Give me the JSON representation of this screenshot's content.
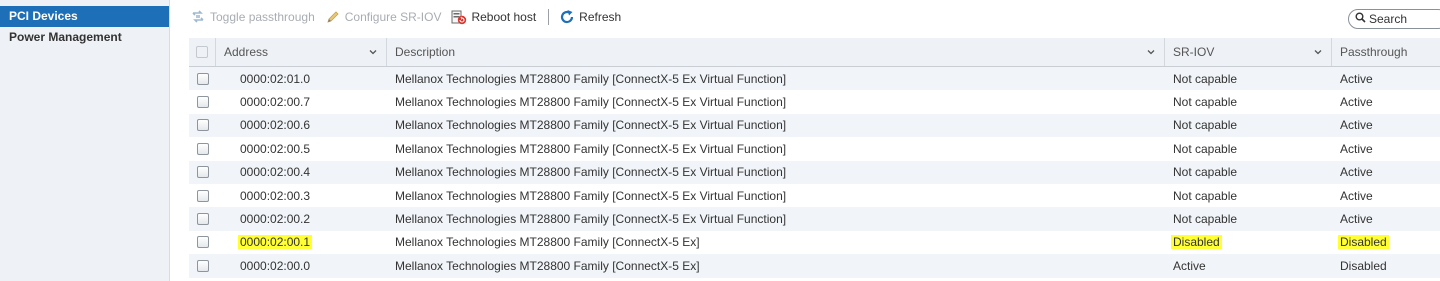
{
  "sidebar": {
    "items": [
      {
        "label": "PCI Devices"
      },
      {
        "label": "Power Management"
      }
    ]
  },
  "toolbar": {
    "toggle_passthrough": "Toggle passthrough",
    "configure_sriov": "Configure SR-IOV",
    "reboot_host": "Reboot host",
    "refresh": "Refresh"
  },
  "search": {
    "placeholder": "Search"
  },
  "table": {
    "columns": {
      "address": "Address",
      "description": "Description",
      "sriov": "SR-IOV",
      "passthrough": "Passthrough"
    },
    "rows": [
      {
        "address": "0000:02:01.0",
        "description": "Mellanox Technologies MT28800 Family [ConnectX-5 Ex Virtual Function]",
        "sriov": "Not capable",
        "passthrough": "Active"
      },
      {
        "address": "0000:02:00.7",
        "description": "Mellanox Technologies MT28800 Family [ConnectX-5 Ex Virtual Function]",
        "sriov": "Not capable",
        "passthrough": "Active"
      },
      {
        "address": "0000:02:00.6",
        "description": "Mellanox Technologies MT28800 Family [ConnectX-5 Ex Virtual Function]",
        "sriov": "Not capable",
        "passthrough": "Active"
      },
      {
        "address": "0000:02:00.5",
        "description": "Mellanox Technologies MT28800 Family [ConnectX-5 Ex Virtual Function]",
        "sriov": "Not capable",
        "passthrough": "Active"
      },
      {
        "address": "0000:02:00.4",
        "description": "Mellanox Technologies MT28800 Family [ConnectX-5 Ex Virtual Function]",
        "sriov": "Not capable",
        "passthrough": "Active"
      },
      {
        "address": "0000:02:00.3",
        "description": "Mellanox Technologies MT28800 Family [ConnectX-5 Ex Virtual Function]",
        "sriov": "Not capable",
        "passthrough": "Active"
      },
      {
        "address": "0000:02:00.2",
        "description": "Mellanox Technologies MT28800 Family [ConnectX-5 Ex Virtual Function]",
        "sriov": "Not capable",
        "passthrough": "Active"
      },
      {
        "address": "0000:02:00.1",
        "description": "Mellanox Technologies MT28800 Family [ConnectX-5 Ex]",
        "sriov": "Disabled",
        "passthrough": "Disabled"
      },
      {
        "address": "0000:02:00.0",
        "description": "Mellanox Technologies MT28800 Family [ConnectX-5 Ex]",
        "sriov": "Active",
        "passthrough": "Disabled"
      }
    ]
  },
  "colors": {
    "accent": "#1d6fb8",
    "highlight": "#ffff33",
    "sidebar_bg": "#eef1f5",
    "row_stripe": "#f1f4f8"
  }
}
